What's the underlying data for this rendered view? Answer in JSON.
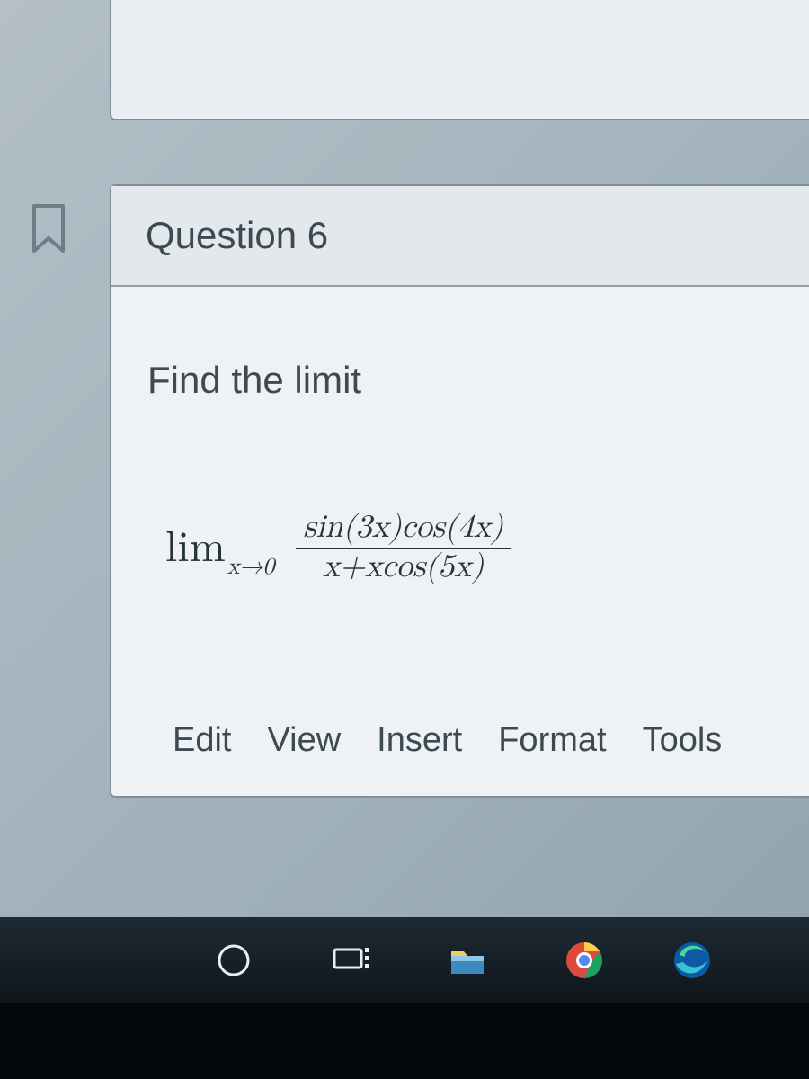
{
  "flag_icon": "bookmark-outline",
  "question": {
    "title": "Question 6",
    "prompt": "Find the limit",
    "math": {
      "lim_label": "lim",
      "lim_subscript": "x→0",
      "numerator": "sin(3x)cos(4x)",
      "denominator": "x+xcos(5x)"
    }
  },
  "editor_menu": [
    "Edit",
    "View",
    "Insert",
    "Format",
    "Tools"
  ],
  "taskbar": {
    "items": [
      {
        "name": "cortana-icon",
        "label": "Cortana / Search"
      },
      {
        "name": "task-view-icon",
        "label": "Task View"
      },
      {
        "name": "file-explorer-icon",
        "label": "File Explorer"
      },
      {
        "name": "chrome-icon",
        "label": "Google Chrome"
      },
      {
        "name": "edge-icon",
        "label": "Microsoft Edge"
      }
    ]
  }
}
